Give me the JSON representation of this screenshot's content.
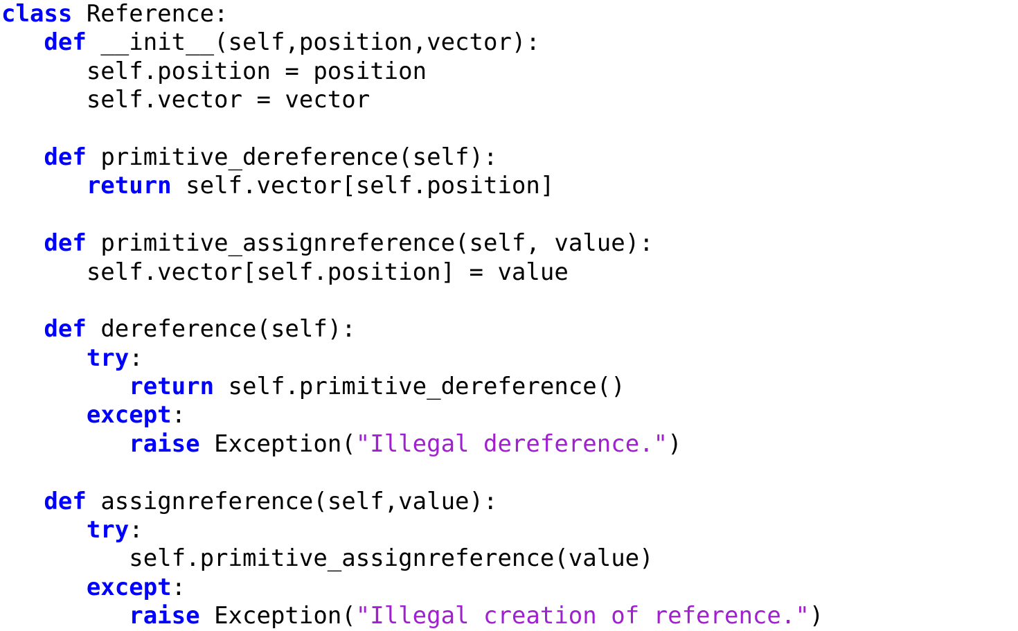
{
  "document": {
    "kind": "python-source-listing",
    "language": "Python",
    "background_color": "#ffffff",
    "colors": {
      "keyword": "#0000ff",
      "string": "#a020d0",
      "plain": "#000000"
    }
  },
  "code": {
    "lines": [
      {
        "index": 1,
        "text": "class Reference:",
        "tokens": [
          {
            "type": "keyword",
            "text": "class"
          },
          {
            "type": "plain",
            "text": " Reference:"
          }
        ]
      },
      {
        "index": 2,
        "text": "   def __init__(self,position,vector):",
        "tokens": [
          {
            "type": "plain",
            "text": "   "
          },
          {
            "type": "keyword",
            "text": "def"
          },
          {
            "type": "plain",
            "text": " __init__(self,position,vector):"
          }
        ]
      },
      {
        "index": 3,
        "text": "      self.position = position",
        "tokens": [
          {
            "type": "plain",
            "text": "      self.position = position"
          }
        ]
      },
      {
        "index": 4,
        "text": "      self.vector = vector",
        "tokens": [
          {
            "type": "plain",
            "text": "      self.vector = vector"
          }
        ]
      },
      {
        "index": 5,
        "text": "",
        "tokens": [
          {
            "type": "plain",
            "text": " "
          }
        ]
      },
      {
        "index": 6,
        "text": "   def primitive_dereference(self):",
        "tokens": [
          {
            "type": "plain",
            "text": "   "
          },
          {
            "type": "keyword",
            "text": "def"
          },
          {
            "type": "plain",
            "text": " primitive_dereference(self):"
          }
        ]
      },
      {
        "index": 7,
        "text": "      return self.vector[self.position]",
        "tokens": [
          {
            "type": "plain",
            "text": "      "
          },
          {
            "type": "keyword",
            "text": "return"
          },
          {
            "type": "plain",
            "text": " self.vector[self.position]"
          }
        ]
      },
      {
        "index": 8,
        "text": "",
        "tokens": [
          {
            "type": "plain",
            "text": " "
          }
        ]
      },
      {
        "index": 9,
        "text": "   def primitive_assignreference(self, value):",
        "tokens": [
          {
            "type": "plain",
            "text": "   "
          },
          {
            "type": "keyword",
            "text": "def"
          },
          {
            "type": "plain",
            "text": " primitive_assignreference(self, value):"
          }
        ]
      },
      {
        "index": 10,
        "text": "      self.vector[self.position] = value",
        "tokens": [
          {
            "type": "plain",
            "text": "      self.vector[self.position] = value"
          }
        ]
      },
      {
        "index": 11,
        "text": "",
        "tokens": [
          {
            "type": "plain",
            "text": " "
          }
        ]
      },
      {
        "index": 12,
        "text": "   def dereference(self):",
        "tokens": [
          {
            "type": "plain",
            "text": "   "
          },
          {
            "type": "keyword",
            "text": "def"
          },
          {
            "type": "plain",
            "text": " dereference(self):"
          }
        ]
      },
      {
        "index": 13,
        "text": "      try:",
        "tokens": [
          {
            "type": "plain",
            "text": "      "
          },
          {
            "type": "keyword",
            "text": "try"
          },
          {
            "type": "plain",
            "text": ":"
          }
        ]
      },
      {
        "index": 14,
        "text": "         return self.primitive_dereference()",
        "tokens": [
          {
            "type": "plain",
            "text": "         "
          },
          {
            "type": "keyword",
            "text": "return"
          },
          {
            "type": "plain",
            "text": " self.primitive_dereference()"
          }
        ]
      },
      {
        "index": 15,
        "text": "      except:",
        "tokens": [
          {
            "type": "plain",
            "text": "      "
          },
          {
            "type": "keyword",
            "text": "except"
          },
          {
            "type": "plain",
            "text": ":"
          }
        ]
      },
      {
        "index": 16,
        "text": "         raise Exception(\"Illegal dereference.\")",
        "tokens": [
          {
            "type": "plain",
            "text": "         "
          },
          {
            "type": "keyword",
            "text": "raise"
          },
          {
            "type": "plain",
            "text": " Exception("
          },
          {
            "type": "string",
            "text": "\"Illegal dereference.\""
          },
          {
            "type": "plain",
            "text": ")"
          }
        ]
      },
      {
        "index": 17,
        "text": "",
        "tokens": [
          {
            "type": "plain",
            "text": " "
          }
        ]
      },
      {
        "index": 18,
        "text": "   def assignreference(self,value):",
        "tokens": [
          {
            "type": "plain",
            "text": "   "
          },
          {
            "type": "keyword",
            "text": "def"
          },
          {
            "type": "plain",
            "text": " assignreference(self,value):"
          }
        ]
      },
      {
        "index": 19,
        "text": "      try:",
        "tokens": [
          {
            "type": "plain",
            "text": "      "
          },
          {
            "type": "keyword",
            "text": "try"
          },
          {
            "type": "plain",
            "text": ":"
          }
        ]
      },
      {
        "index": 20,
        "text": "         self.primitive_assignreference(value)",
        "tokens": [
          {
            "type": "plain",
            "text": "         self.primitive_assignreference(value)"
          }
        ]
      },
      {
        "index": 21,
        "text": "      except:",
        "tokens": [
          {
            "type": "plain",
            "text": "      "
          },
          {
            "type": "keyword",
            "text": "except"
          },
          {
            "type": "plain",
            "text": ":"
          }
        ]
      },
      {
        "index": 22,
        "text": "         raise Exception(\"Illegal creation of reference.\")",
        "tokens": [
          {
            "type": "plain",
            "text": "         "
          },
          {
            "type": "keyword",
            "text": "raise"
          },
          {
            "type": "plain",
            "text": " Exception("
          },
          {
            "type": "string",
            "text": "\"Illegal creation of reference.\""
          },
          {
            "type": "plain",
            "text": ")"
          }
        ]
      }
    ]
  }
}
